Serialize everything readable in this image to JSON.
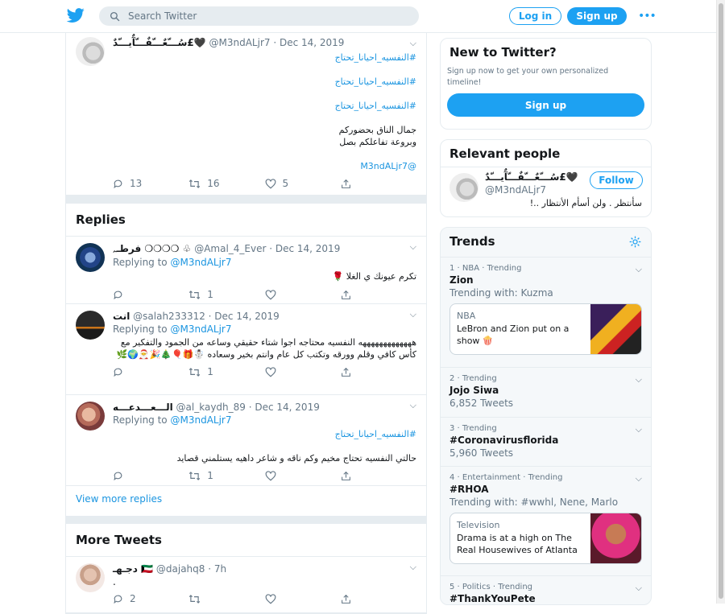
{
  "header": {
    "search_placeholder": "Search Twitter",
    "login_label": "Log in",
    "signup_label": "Sign up",
    "more_label": "•••"
  },
  "main_tweet": {
    "name": "سُـــّعٌـــّفٌـــّآٌيـــّدٌ£🖤",
    "handle_date": "@M3ndALjr7 · Dec 14, 2019",
    "lines": [
      "#النفسيه_احيانا_تحتاج",
      "#النفسيه_احيانا_تحتاج",
      "#النفسيه_احيانا_تحتاج",
      "جمال الناق بحضوركم",
      "وبروعة تفاعلكم بصل",
      "@M3ndALjr7"
    ],
    "replies": "13",
    "retweets": "16",
    "likes": "5"
  },
  "replies_section": {
    "title": "Replies",
    "view_more": "View more replies",
    "items": [
      {
        "name": "فرطـﮧ ❍❍❍❍ ♧",
        "handle_date": "@Amal_4_Ever · Dec 14, 2019",
        "replying_prefix": "Replying to",
        "replying_to": "@M3ndALjr7",
        "text": "تكرم عيونك ي الغلا 🌹",
        "replies": "",
        "retweets": "1",
        "likes": ""
      },
      {
        "name": "انت",
        "handle_date": "@salah233312 · Dec 14, 2019",
        "replying_prefix": "Replying to",
        "replying_to": "@M3ndALjr7",
        "text": "هههههههههههههه النفسيه محتاجه اجوا شتاء حقيقي وساعه من الجمود والتفكير مع كأس كافي وقلم وورقه وتكتب كل عام وانتم بخير وسعاده ☃️🎁🎈🎄🎉🎅🌍🌿",
        "replies": "",
        "retweets": "1",
        "likes": ""
      },
      {
        "name": "الـــعـــدعـــه",
        "handle_date": "@al_kaydh_89 · Dec 14, 2019",
        "replying_prefix": "Replying to",
        "replying_to": "@M3ndALjr7",
        "text": "#النفسيه_احيانا_تحتاج",
        "text2": "حالتي النفسيه تحتاج مخيم وكم ناقه و شاعر داهيه يستلمني قصايد",
        "replies": "",
        "retweets": "1",
        "likes": ""
      }
    ]
  },
  "more_tweets": {
    "title": "More Tweets",
    "item": {
      "name": "دجـهـ 🇰🇼",
      "handle_date": "@dajahq8 · 7h",
      "text": ".",
      "replies": "2"
    }
  },
  "new_to_twitter": {
    "title": "New to Twitter?",
    "desc": "Sign up now to get your own personalized timeline!",
    "signup": "Sign up"
  },
  "relevant": {
    "title": "Relevant people",
    "name": "سُـــّعٌـــّفٌـــّآٌيـــّدٌ£🖤",
    "handle": "@M3ndALjr7",
    "follow": "Follow",
    "bio": "سأنتظر . ولن أسأم الأنتظار ..!"
  },
  "trends": {
    "title": "Trends",
    "items": [
      {
        "meta": "1 · NBA · Trending",
        "name": "Zion",
        "sub": "Trending with: Kuzma",
        "news": {
          "cat": "NBA",
          "head": "LeBron and Zion put on a show 🍿"
        }
      },
      {
        "meta": "2 · Trending",
        "name": "Jojo Siwa",
        "sub": "6,852 Tweets"
      },
      {
        "meta": "3 · Trending",
        "name": "#Coronavirusflorida",
        "sub": "5,960 Tweets"
      },
      {
        "meta": "4 · Entertainment · Trending",
        "name": "#RHOA",
        "sub": "Trending with: #wwhl, Nene, Marlo",
        "news": {
          "cat": "Television",
          "head": "Drama is at a high on The Real Housewives of Atlanta"
        }
      },
      {
        "meta": "5 · Politics · Trending",
        "name": "#ThankYouPete"
      }
    ]
  },
  "colors": {
    "brand": "#1da1f2",
    "link": "#1b95e0",
    "muted": "#657786"
  }
}
